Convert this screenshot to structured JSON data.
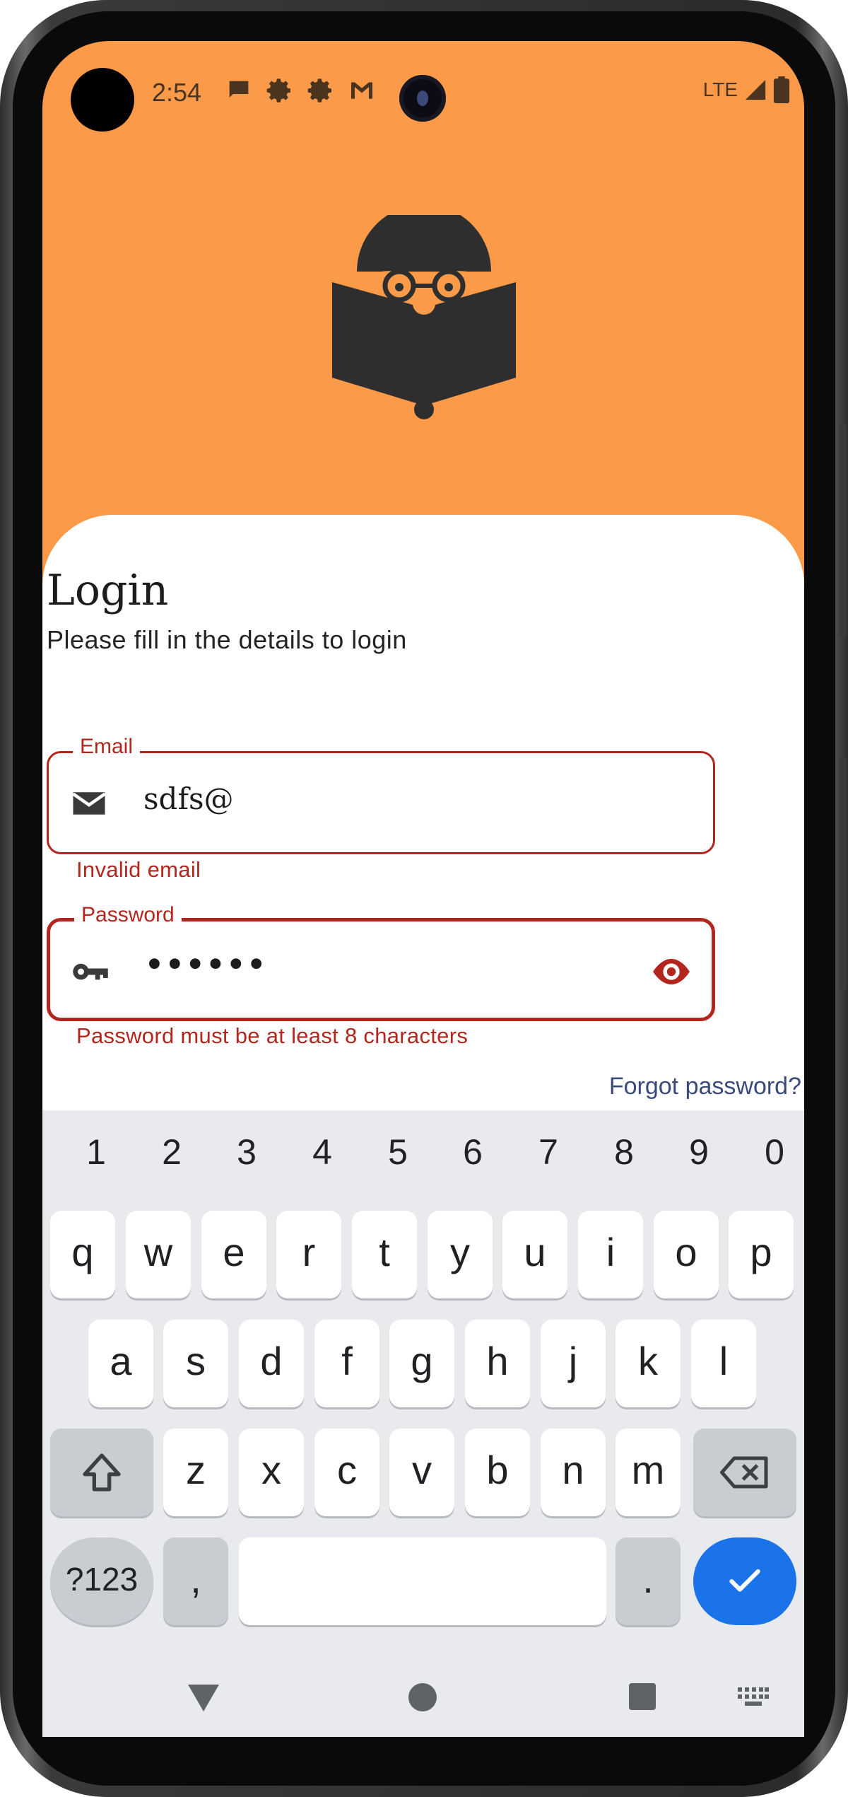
{
  "status_bar": {
    "time": "2:54",
    "network": "LTE",
    "icons": [
      "chat-bubble-icon",
      "settings-icon",
      "settings-icon",
      "gmail-icon",
      "signal-icon",
      "battery-icon"
    ]
  },
  "login": {
    "title": "Login",
    "subtitle": "Please fill in the details to login",
    "email_label": "Email",
    "email_value": "sdfs@",
    "email_error": "Invalid email",
    "password_label": "Password",
    "password_value": "••••••",
    "password_error": "Password must be at least 8 characters",
    "forgot_link": "Forgot password?"
  },
  "keyboard": {
    "numbers": [
      "1",
      "2",
      "3",
      "4",
      "5",
      "6",
      "7",
      "8",
      "9",
      "0"
    ],
    "row1": [
      "q",
      "w",
      "e",
      "r",
      "t",
      "y",
      "u",
      "i",
      "o",
      "p"
    ],
    "row2": [
      "a",
      "s",
      "d",
      "f",
      "g",
      "h",
      "j",
      "k",
      "l"
    ],
    "row3": [
      "z",
      "x",
      "c",
      "v",
      "b",
      "n",
      "m"
    ],
    "symbols_key": "?123",
    "comma_key": ",",
    "period_key": "."
  },
  "colors": {
    "header_bg": "#fb9b4a",
    "error": "#b3261e",
    "link": "#3a4a7a",
    "enter_key": "#1a73e8"
  }
}
